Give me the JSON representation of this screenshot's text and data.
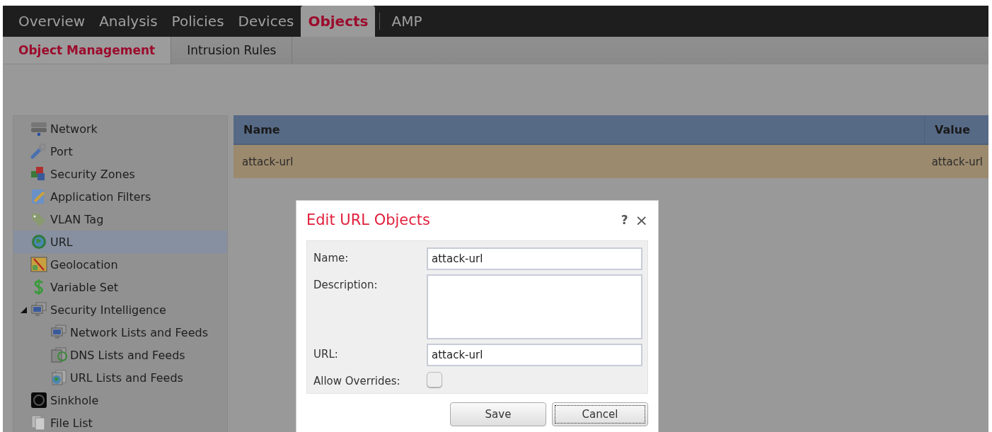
{
  "nav": {
    "tabs": [
      {
        "label": "Overview",
        "selected": false
      },
      {
        "label": "Analysis",
        "selected": false
      },
      {
        "label": "Policies",
        "selected": false
      },
      {
        "label": "Devices",
        "selected": false
      },
      {
        "label": "Objects",
        "selected": true
      },
      {
        "label": "AMP",
        "selected": false
      }
    ]
  },
  "subnav": {
    "tabs": [
      {
        "label": "Object Management",
        "selected": true
      },
      {
        "label": "Intrusion Rules",
        "selected": false
      }
    ]
  },
  "sidebar": {
    "items": [
      {
        "label": "Network",
        "selected": false
      },
      {
        "label": "Port",
        "selected": false
      },
      {
        "label": "Security Zones",
        "selected": false
      },
      {
        "label": "Application Filters",
        "selected": false
      },
      {
        "label": "VLAN Tag",
        "selected": false
      },
      {
        "label": "URL",
        "selected": true
      },
      {
        "label": "Geolocation",
        "selected": false
      },
      {
        "label": "Variable Set",
        "selected": false
      },
      {
        "label": "Security Intelligence",
        "selected": false,
        "expanded": true,
        "children": [
          {
            "label": "Network Lists and Feeds",
            "selected": false
          },
          {
            "label": "DNS Lists and Feeds",
            "selected": false
          },
          {
            "label": "URL Lists and Feeds",
            "selected": false
          }
        ]
      },
      {
        "label": "Sinkhole",
        "selected": false
      },
      {
        "label": "File List",
        "selected": false
      }
    ]
  },
  "table": {
    "columns": [
      "Name",
      "Value"
    ],
    "rows": [
      {
        "cells": [
          "attack-url",
          "attack-url"
        ],
        "selected": true
      }
    ]
  },
  "dialog": {
    "title": "Edit URL Objects",
    "help": "?",
    "close": "×",
    "fields": [
      {
        "kind": "text",
        "label": "Name:",
        "value": "attack-url"
      },
      {
        "kind": "textarea",
        "label": "Description:"
      },
      {
        "kind": "text",
        "label": "URL:",
        "value": "attack-url"
      },
      {
        "kind": "checkbox",
        "label": "Allow Overrides:",
        "checked": false
      }
    ],
    "buttons": [
      {
        "label": "Save",
        "focused": false
      },
      {
        "label": "Cancel",
        "focused": true
      }
    ]
  }
}
